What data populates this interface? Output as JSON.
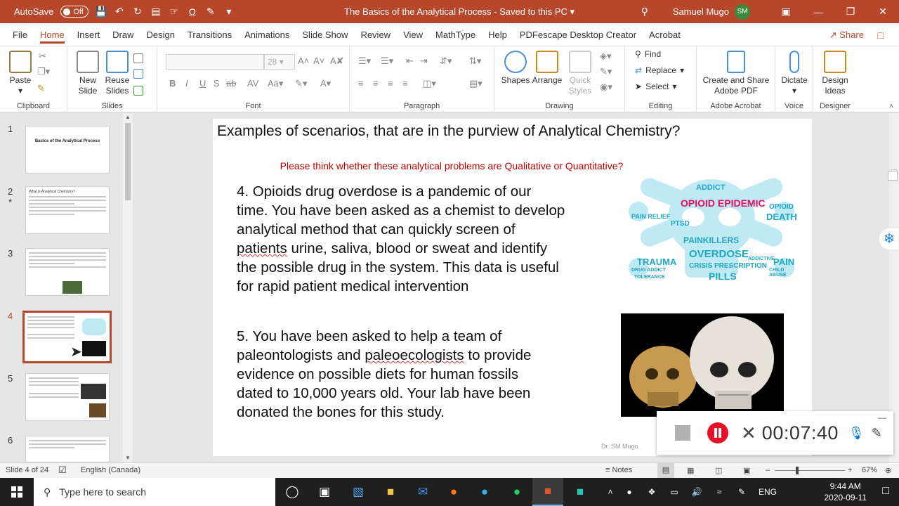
{
  "titlebar": {
    "autosave_label": "AutoSave",
    "autosave_state": "Off",
    "doc_title": "The Basics of the Analytical Process  -  Saved to this PC",
    "user_name": "Samuel Mugo",
    "user_initials": "SM"
  },
  "menu": {
    "items": [
      "File",
      "Home",
      "Insert",
      "Draw",
      "Design",
      "Transitions",
      "Animations",
      "Slide Show",
      "Review",
      "View",
      "MathType",
      "Help",
      "PDFescape Desktop Creator",
      "Acrobat"
    ],
    "active": "Home",
    "share_label": "Share"
  },
  "ribbon": {
    "clipboard": {
      "label": "Clipboard",
      "paste": "Paste"
    },
    "slides": {
      "label": "Slides",
      "new_slide": "New\nSlide",
      "reuse_slides": "Reuse\nSlides"
    },
    "font": {
      "label": "Font",
      "size": "28"
    },
    "paragraph": {
      "label": "Paragraph"
    },
    "drawing": {
      "label": "Drawing",
      "shapes": "Shapes",
      "arrange": "Arrange",
      "quick_styles": "Quick\nStyles"
    },
    "editing": {
      "label": "Editing",
      "find": "Find",
      "replace": "Replace",
      "select": "Select"
    },
    "adobe": {
      "label": "Adobe Acrobat",
      "create_share": "Create and Share\nAdobe PDF"
    },
    "voice": {
      "label": "Voice",
      "dictate": "Dictate"
    },
    "designer": {
      "label": "Designer",
      "design_ideas": "Design\nIdeas"
    }
  },
  "thumbnails": {
    "items": [
      {
        "num": "1",
        "title": "Basics of the Analytical Process"
      },
      {
        "num": "2",
        "title": "What is Analytical Chemistry?"
      },
      {
        "num": "3",
        "title": ""
      },
      {
        "num": "4",
        "title": ""
      },
      {
        "num": "5",
        "title": ""
      },
      {
        "num": "6",
        "title": ""
      }
    ],
    "active": "4"
  },
  "slide": {
    "title": "Examples of scenarios, that are in the purview of Analytical Chemistry?",
    "subtitle": "Please think whether  these analytical problems are Qualitative or Quantitative?",
    "p4_line1": "4. Opioids drug overdose is a pandemic of our",
    "p4_line2": "time. You have been asked as a chemist to develop",
    "p4_line3": "analytical method that can quickly screen of",
    "p4_line4a": "patients",
    "p4_line4b": " urine, saliva, blood or sweat and identify",
    "p4_line5": "the possible drug in the system. This data is useful",
    "p4_line6": "for rapid patient medical intervention",
    "p5_line1": "5. You have been asked to help a team of",
    "p5_line2a": "paleontologists and ",
    "p5_line2b": "paleoecologists",
    "p5_line2c": " to provide",
    "p5_line3": "evidence on possible diets for human fossils",
    "p5_line4": "dated to 10,000 years old. Your lab have been",
    "p5_line5": "donated the bones for this study.",
    "footer": "Dr. SM Mugo",
    "cloud_words": {
      "headline": "OPIOID EPIDEMIC",
      "w1": "ADDICT",
      "w2": "PAIN RELIEF",
      "w3": "PTSD",
      "w4": "DEATH",
      "w5": "OPIOID",
      "w6": "PAINKILLERS",
      "w7": "OVERDOSE",
      "w8": "TRAUMA",
      "w9": "CRISIS",
      "w10": "PRESCRIPTION",
      "w11": "PILLS",
      "w12": "PAIN",
      "w13": "DRUG ADDICT",
      "w14": "ADDICTIVE",
      "w15": "TOLERANCE",
      "w16": "CHILD ABUSE"
    }
  },
  "recorder": {
    "time": "00:07:40"
  },
  "statusbar": {
    "slide_info": "Slide 4 of 24",
    "language": "English (Canada)",
    "notes": "Notes",
    "zoom": "67%"
  },
  "taskbar": {
    "search_placeholder": "Type here to search",
    "lang": "ENG",
    "time": "9:44 AM",
    "date": "2020-09-11"
  },
  "colors": {
    "accent": "#b7472a",
    "subtitle_red": "#c00000",
    "cloud_blue": "#1fa7c4",
    "record_red": "#e81123"
  }
}
